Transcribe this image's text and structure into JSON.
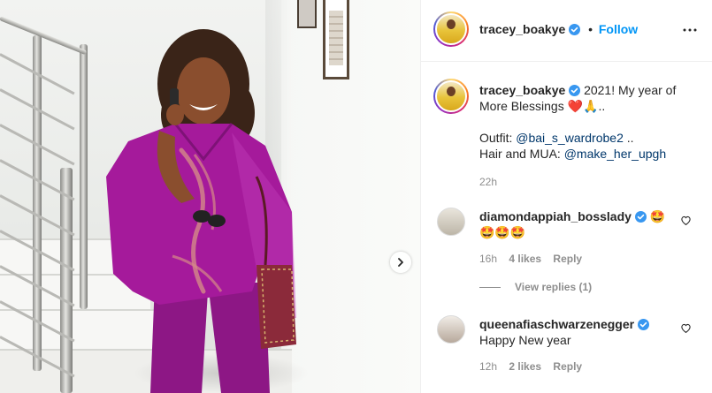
{
  "post": {
    "username": "tracey_boakye",
    "separator": "•",
    "follow_label": "Follow",
    "caption_line1": "2021! My year of",
    "caption_line2": "More Blessings",
    "caption_emoji": "❤️🙏..",
    "outfit_label": "Outfit:",
    "outfit_mention": "@bai_s_wardrobe2",
    "outfit_suffix": "..",
    "hair_label": "Hair and MUA:",
    "hair_mention": "@make_her_upgh",
    "caption_time": "22h"
  },
  "comments": [
    {
      "username": "diamondappiah_bosslady",
      "text_inline": "🤩",
      "text": "🤩🤩🤩",
      "time": "16h",
      "likes": "4 likes",
      "reply_label": "Reply",
      "view_replies": "View replies (1)"
    },
    {
      "username": "queenafiaschwarzenegger",
      "text": "Happy New year",
      "time": "12h",
      "likes": "2 likes",
      "reply_label": "Reply"
    }
  ],
  "colors": {
    "follow": "#0095f6",
    "verified": "#3897f0",
    "mention": "#00376b",
    "muted": "#8e8e8e",
    "dress": "#a51a9b"
  },
  "icons": {
    "more": "more-options-icon",
    "verified": "verified-badge-icon",
    "heart": "heart-outline-icon",
    "next": "chevron-right-icon"
  }
}
